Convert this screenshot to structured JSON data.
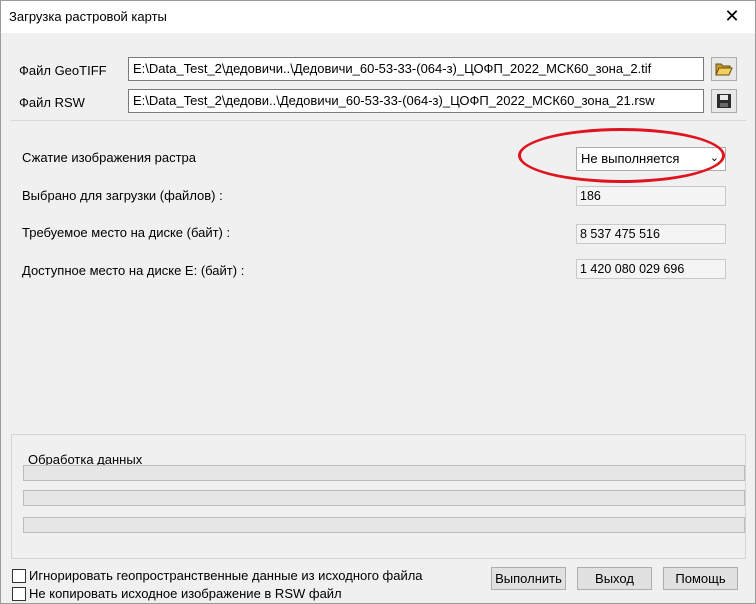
{
  "window": {
    "title": "Загрузка растровой карты",
    "close": "✕"
  },
  "files": {
    "geotiff_label": "Файл  GeoTIFF",
    "geotiff_path": "E:\\Data_Test_2\\дедовичи..\\Дедовичи_60-53-33-(064-з)_ЦОФП_2022_МСК60_зона_2.tif",
    "rsw_label": "Файл  RSW",
    "rsw_path": "E:\\Data_Test_2\\дедови..\\Дедовичи_60-53-33-(064-з)_ЦОФП_2022_МСК60_зона_21.rsw"
  },
  "compression": {
    "label": "Сжатие изображения растра",
    "selected": "Не выполняется"
  },
  "info": {
    "selected_label": "Выбрано для загрузки (файлов) :",
    "selected_value": "186",
    "required_label": "Требуемое место на диске (байт) :",
    "required_value": "8 537 475 516",
    "available_label": "Доступное место на диске E: (байт) :",
    "available_value": "1 420 080 029 696"
  },
  "processing": {
    "title": "Обработка данных"
  },
  "options": {
    "ignore_geo": "Игнорировать геопространственные данные из исходного файла",
    "no_copy": "Не копировать исходное изображение в RSW файл"
  },
  "buttons": {
    "run": "Выполнить",
    "exit": "Выход",
    "help": "Помощь"
  },
  "colors": {
    "annotation": "#e0141e"
  }
}
